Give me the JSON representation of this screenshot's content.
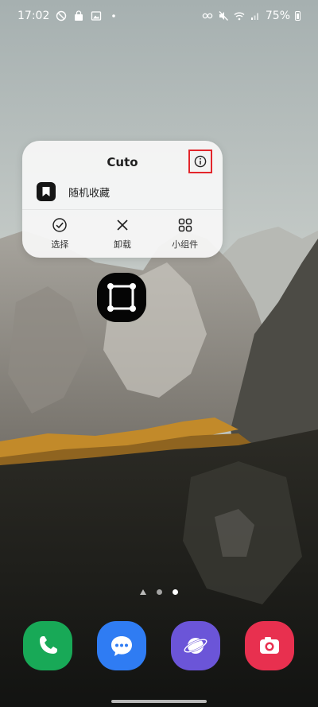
{
  "status_bar": {
    "time": "17:02",
    "battery_percent": "75%"
  },
  "popup": {
    "app_name": "Cuto",
    "shortcut_label": "随机收藏",
    "actions": [
      {
        "label": "选择",
        "icon": "check-circle-icon"
      },
      {
        "label": "卸载",
        "icon": "close-icon"
      },
      {
        "label": "小组件",
        "icon": "widgets-icon"
      }
    ]
  },
  "page_indicator": {
    "pages": 2,
    "current": 2
  },
  "dock": {
    "apps": [
      {
        "name": "Phone",
        "icon": "phone-icon",
        "color": "#18a957"
      },
      {
        "name": "Messages",
        "icon": "message-icon",
        "color": "#2f7cf3"
      },
      {
        "name": "Internet",
        "icon": "internet-icon",
        "color": "#6b55d8"
      },
      {
        "name": "Camera",
        "icon": "camera-icon",
        "color": "#e8304f"
      }
    ]
  },
  "colors": {
    "highlight_border": "#e3262b",
    "popup_bg": "#f6f7f7"
  }
}
